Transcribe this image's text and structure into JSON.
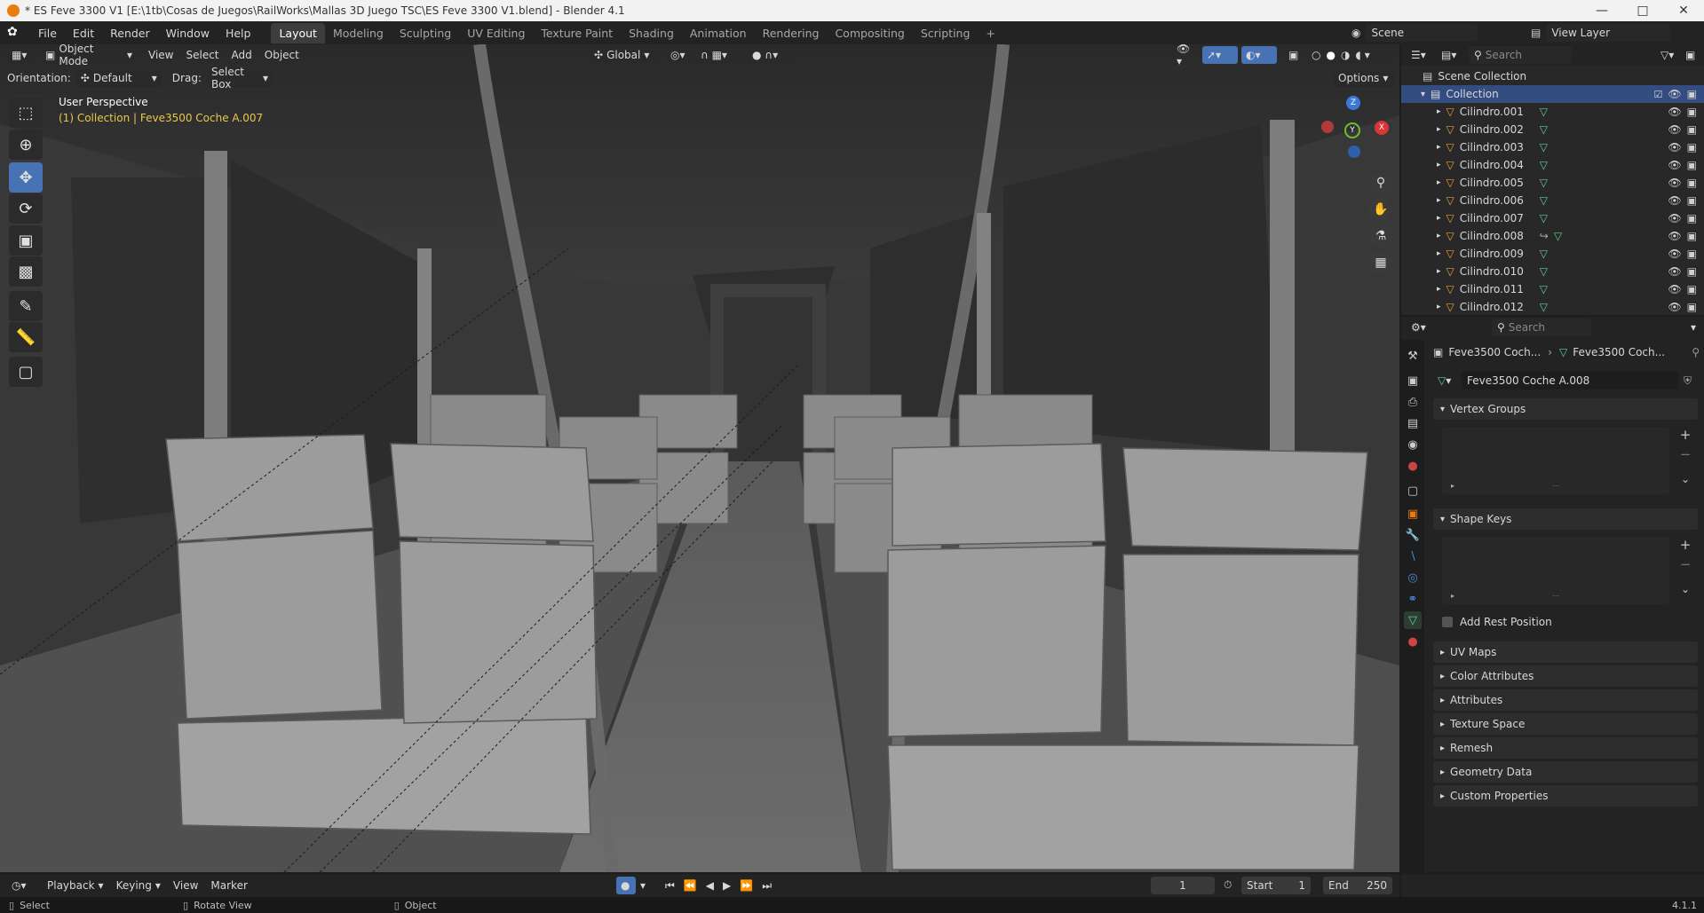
{
  "window": {
    "title": "* ES Feve 3300 V1 [E:\\1tb\\Cosas de Juegos\\RailWorks\\Mallas 3D Juego TSC\\ES Feve 3300 V1.blend] - Blender 4.1"
  },
  "menu": [
    "File",
    "Edit",
    "Render",
    "Window",
    "Help"
  ],
  "workspaces": [
    "Layout",
    "Modeling",
    "Sculpting",
    "UV Editing",
    "Texture Paint",
    "Shading",
    "Animation",
    "Rendering",
    "Compositing",
    "Scripting"
  ],
  "active_workspace": "Layout",
  "scene": {
    "name": "Scene",
    "view_layer": "View Layer"
  },
  "viewport_header": {
    "mode": "Object Mode",
    "menus": [
      "View",
      "Select",
      "Add",
      "Object"
    ],
    "transform": "Global"
  },
  "tool_settings": {
    "orientation_label": "Orientation:",
    "orientation_value": "Default",
    "drag_label": "Drag:",
    "drag_value": "Select Box",
    "options": "Options"
  },
  "viewport": {
    "perspective": "User Perspective",
    "context": "(1) Collection | Feve3500 Coche A.007"
  },
  "outliner": {
    "search_placeholder": "Search",
    "scene_collection": "Scene Collection",
    "collection": "Collection",
    "objects": [
      "Cilindro.001",
      "Cilindro.002",
      "Cilindro.003",
      "Cilindro.004",
      "Cilindro.005",
      "Cilindro.006",
      "Cilindro.007",
      "Cilindro.008",
      "Cilindro.009",
      "Cilindro.010",
      "Cilindro.011",
      "Cilindro.012"
    ]
  },
  "properties": {
    "search_placeholder": "Search",
    "breadcrumb_object": "Feve3500 Coch...",
    "breadcrumb_mesh": "Feve3500 Coch...",
    "mesh_name": "Feve3500 Coche A.008",
    "panels": {
      "vertex_groups": "Vertex Groups",
      "shape_keys": "Shape Keys",
      "add_rest_position": "Add Rest Position",
      "uv_maps": "UV Maps",
      "color_attributes": "Color Attributes",
      "attributes": "Attributes",
      "texture_space": "Texture Space",
      "remesh": "Remesh",
      "geometry_data": "Geometry Data",
      "custom_properties": "Custom Properties"
    }
  },
  "timeline": {
    "playback": "Playback",
    "keying": "Keying",
    "view": "View",
    "marker": "Marker",
    "current_frame": "1",
    "start_label": "Start",
    "start": "1",
    "end_label": "End",
    "end": "250"
  },
  "statusbar": {
    "select": "Select",
    "rotate": "Rotate View",
    "object": "Object",
    "version": "4.1.1"
  },
  "gizmo": {
    "z": "Z",
    "y": "Y",
    "x": "X"
  },
  "colors": {
    "accent": "#4772b3",
    "orange": "#e87d0d",
    "context_yellow": "#e8c84a"
  }
}
